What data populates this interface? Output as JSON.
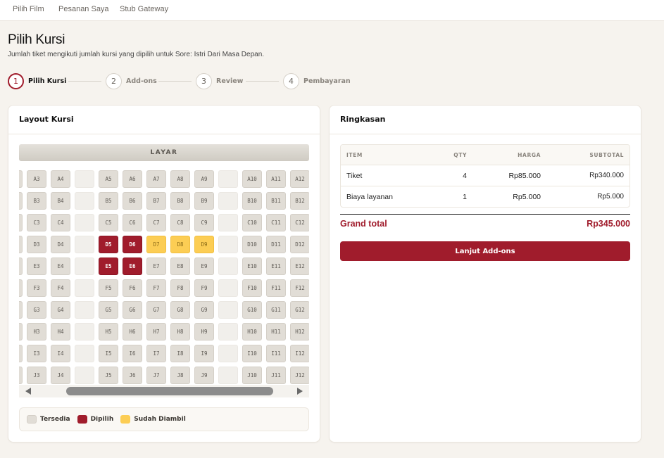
{
  "nav": {
    "items": [
      "Pilih Film",
      "Pesanan Saya",
      "Stub Gateway"
    ]
  },
  "page": {
    "title": "Pilih Kursi",
    "subtitle": "Jumlah tiket mengikuti jumlah kursi yang dipilih untuk Sore: Istri Dari Masa Depan."
  },
  "stepper": [
    {
      "num": "1",
      "label": "Pilih Kursi",
      "active": true
    },
    {
      "num": "2",
      "label": "Add-ons",
      "active": false
    },
    {
      "num": "3",
      "label": "Review",
      "active": false
    },
    {
      "num": "4",
      "label": "Pembayaran",
      "active": false
    }
  ],
  "seat_card": {
    "title": "Layout Kursi",
    "screen_label": "LAYAR",
    "rows": [
      "A",
      "B",
      "C",
      "D",
      "E",
      "F",
      "G",
      "H",
      "I",
      "J"
    ],
    "columns": [
      3,
      4,
      "aisle",
      5,
      6,
      7,
      8,
      9,
      "aisle",
      10,
      11,
      12
    ],
    "selected": [
      "D5",
      "D6",
      "E5",
      "E6"
    ],
    "taken": [
      "D7",
      "D8",
      "D9"
    ],
    "legend": [
      {
        "label": "Tersedia",
        "color": "#e1ddd6"
      },
      {
        "label": "Dipilih",
        "color": "#a01c2c"
      },
      {
        "label": "Sudah Diambil",
        "color": "#fccd54"
      }
    ]
  },
  "summary": {
    "title": "Ringkasan",
    "headers": {
      "item": "ITEM",
      "qty": "QTY",
      "harga": "HARGA",
      "subtotal": "SUBTOTAL"
    },
    "rows": [
      {
        "item": "Tiket",
        "qty": "4",
        "harga": "Rp85.000",
        "subtotal": "Rp340.000"
      },
      {
        "item": "Biaya layanan",
        "qty": "1",
        "harga": "Rp5.000",
        "subtotal": "Rp5.000"
      }
    ],
    "grand_total_label": "Grand total",
    "grand_total_value": "Rp345.000",
    "cta_label": "Lanjut Add-ons"
  },
  "colors": {
    "accent": "#a01c2c",
    "taken": "#fccd54",
    "available": "#e1ddd6"
  },
  "icons": {
    "scroll_left": "triangle-left-icon",
    "scroll_right": "triangle-right-icon"
  }
}
